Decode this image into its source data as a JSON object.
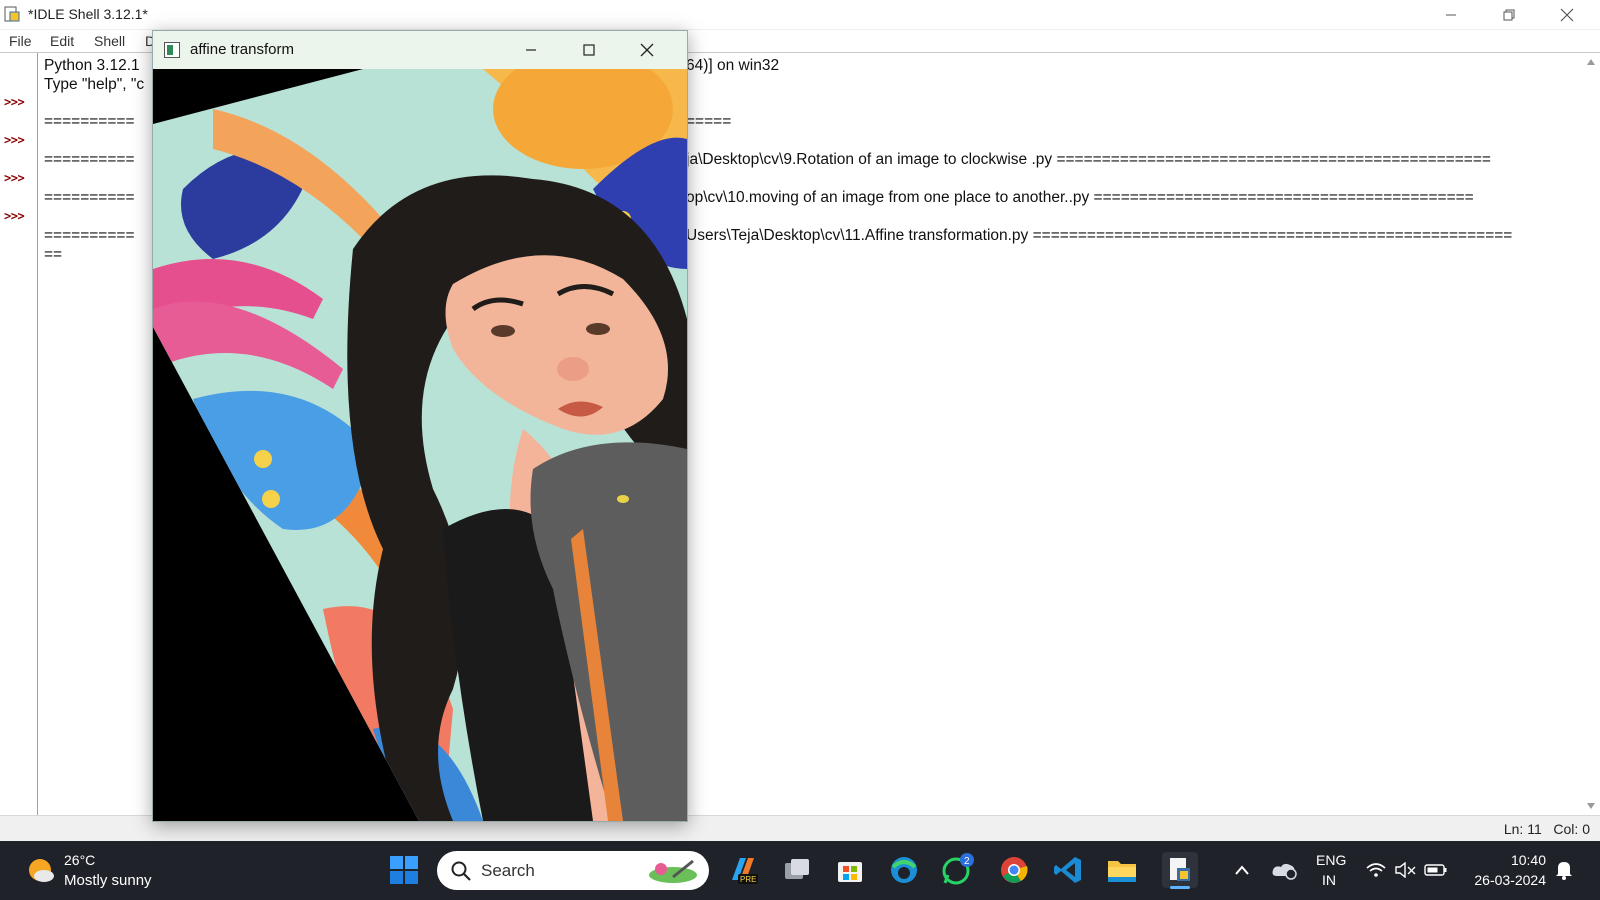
{
  "idle": {
    "title": "*IDLE Shell 3.12.1*",
    "menu": [
      "File",
      "Edit",
      "Shell",
      "D"
    ],
    "prompts": [
      ">>>",
      ">>>",
      ">>>",
      ">>>"
    ],
    "lines_left": [
      "Python 3.12.1",
      "Type \"help\", \"c",
      "==========",
      "==========",
      "==========",
      "==========",
      "=="
    ],
    "lines_right": [
      "64)] on win32",
      "=====",
      "ja\\Desktop\\cv\\9.Rotation of an image to clockwise .py ================================================",
      "op\\cv\\10.moving of an image from one place to another..py ==========================================",
      "Users\\Teja\\Desktop\\cv\\11.Affine transformation.py ====================================================="
    ],
    "status": "Ln: 11   Col: 0"
  },
  "cv_window": {
    "title": "affine transform"
  },
  "taskbar": {
    "weather_temp": "26°C",
    "weather_desc": "Mostly sunny",
    "search_label": "Search",
    "whatsapp_badge": "2",
    "lang_line1": "ENG",
    "lang_line2": "IN",
    "time": "10:40",
    "date": "26-03-2024"
  }
}
